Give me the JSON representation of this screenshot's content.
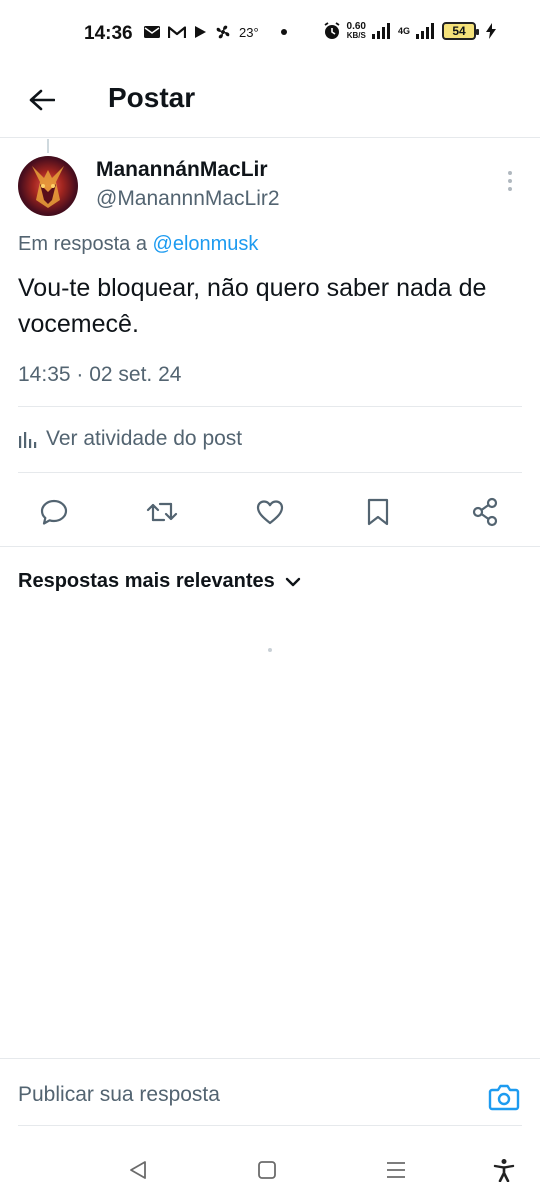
{
  "status_bar": {
    "time": "14:36",
    "temperature": "23°",
    "speed_value": "0.60",
    "speed_unit": "KB/S",
    "network": "4G",
    "battery": "54"
  },
  "header": {
    "title": "Postar"
  },
  "post": {
    "author_name": "ManannánMacLir",
    "author_handle": "@ManannnMacLir2",
    "reply_prefix": "Em resposta a",
    "reply_mention": "@elonmusk",
    "text": "Vou-te bloquear, não quero saber nada de vocemecê.",
    "timestamp": "14:35 · 02 set. 24",
    "activity_label": "Ver atividade do post"
  },
  "actions": [
    "reply-icon",
    "repost-icon",
    "like-icon",
    "bookmark-icon",
    "share-icon"
  ],
  "replies": {
    "sort_label": "Respostas mais relevantes"
  },
  "composer": {
    "placeholder": "Publicar sua resposta"
  },
  "colors": {
    "accent": "#1d9bf0",
    "text_primary": "#0f1419",
    "text_secondary": "#536471",
    "divider": "#e6e9ec"
  }
}
